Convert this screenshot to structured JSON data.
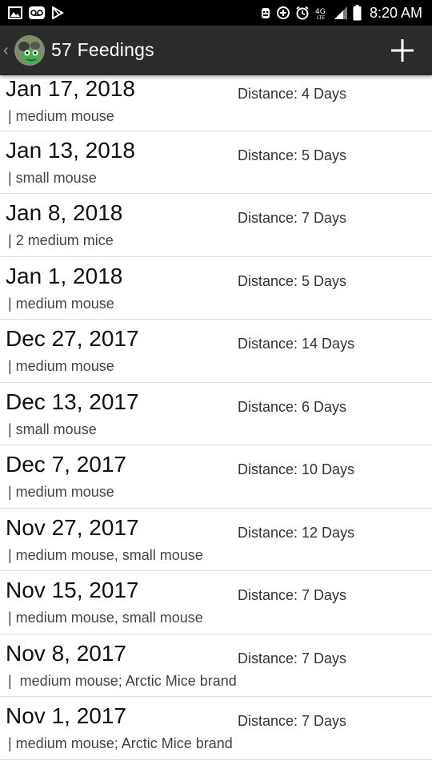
{
  "status_bar": {
    "time": "8:20 AM",
    "left_icons": [
      "gallery-icon",
      "voicemail-icon",
      "play-store-icon"
    ],
    "right_icons": [
      "bug-icon",
      "data-saver-icon",
      "alarm-icon",
      "lte-icon",
      "signal-icon",
      "battery-icon"
    ]
  },
  "app_bar": {
    "title": "57 Feedings",
    "back_icon": "chevron-left-icon",
    "avatar_icon": "frog-avatar-icon",
    "add_icon": "plus-icon"
  },
  "feedings": [
    {
      "date": "Jan 17, 2018",
      "distance": "Distance: 4 Days",
      "note": "| medium mouse"
    },
    {
      "date": "Jan 13, 2018",
      "distance": "Distance: 5 Days",
      "note": "| small mouse"
    },
    {
      "date": "Jan 8, 2018",
      "distance": "Distance: 7 Days",
      "note": "| 2 medium mice"
    },
    {
      "date": "Jan 1, 2018",
      "distance": "Distance: 5 Days",
      "note": "| medium mouse"
    },
    {
      "date": "Dec 27, 2017",
      "distance": "Distance: 14 Days",
      "note": "| medium mouse"
    },
    {
      "date": "Dec 13, 2017",
      "distance": "Distance: 6 Days",
      "note": "| small mouse"
    },
    {
      "date": "Dec 7, 2017",
      "distance": "Distance: 10 Days",
      "note": "| medium mouse"
    },
    {
      "date": "Nov 27, 2017",
      "distance": "Distance: 12 Days",
      "note": "| medium mouse, small mouse"
    },
    {
      "date": "Nov 15, 2017",
      "distance": "Distance: 7 Days",
      "note": "| medium mouse, small mouse"
    },
    {
      "date": "Nov 8, 2017",
      "distance": "Distance: 7 Days",
      "note": "|  medium mouse; Arctic Mice brand"
    },
    {
      "date": "Nov 1, 2017",
      "distance": "Distance: 7 Days",
      "note": "| medium mouse; Arctic Mice brand"
    }
  ],
  "colors": {
    "status_bar": "#000000",
    "app_bar": "#2b2b2b",
    "divider": "#dcdcdc",
    "text_primary": "#111111"
  }
}
